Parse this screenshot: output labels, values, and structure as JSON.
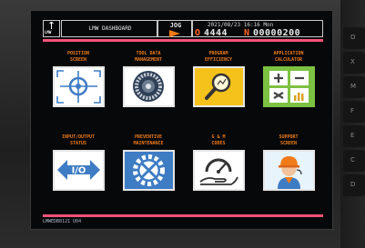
{
  "header": {
    "logo_text": "LMW",
    "title": "LMW DASHBOARD",
    "mode": "JOG",
    "datetime": "2021/08/23 16:16 Mon",
    "program_prefix": "O",
    "program_number": "4444",
    "sequence_prefix": "N",
    "sequence_number": "00000200"
  },
  "tiles": [
    {
      "label": "POSITION\nSCREEN",
      "icon": "crosshair-icon"
    },
    {
      "label": "TOOL DATA\nMANAGEMENT",
      "icon": "tool-turret-icon"
    },
    {
      "label": "PROGRAM\nEFFICIENCY",
      "icon": "magnifier-icon"
    },
    {
      "label": "APPLICATION\nCALCULATOR",
      "icon": "calculator-icon"
    },
    {
      "label": "INPUT/OUTPUT\nSTATUS",
      "icon": "io-arrows-icon"
    },
    {
      "label": "PREVENTIVE\nMAINTENANCE",
      "icon": "wrench-gear-icon"
    },
    {
      "label": "G & M\nCODES",
      "icon": "gauge-hand-icon"
    },
    {
      "label": "SUPPORT\nSCREEN",
      "icon": "engineer-icon"
    }
  ],
  "footer": {
    "version": "LMWEDB8121 U04"
  },
  "side_keys": [
    "O",
    "X",
    "M",
    "F",
    "E",
    "C",
    "D"
  ],
  "colors": {
    "accent": "#f07b18",
    "pink_line": "#f3527a",
    "screen_bg": "#07080a"
  }
}
